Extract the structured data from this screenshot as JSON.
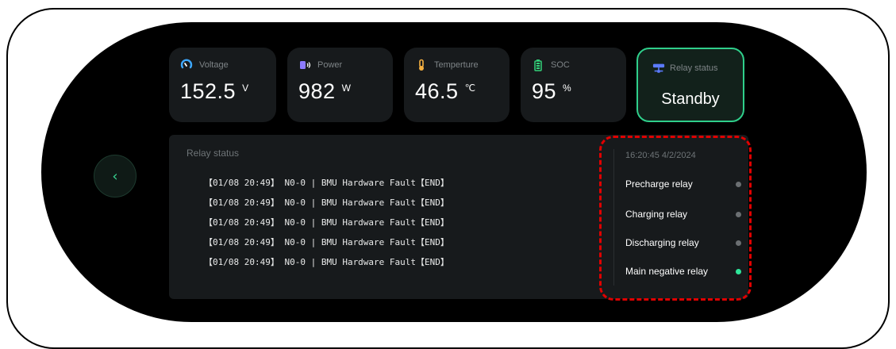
{
  "metrics": [
    {
      "label": "Voltage",
      "value": "152.5",
      "unit": "V",
      "icon": "gauge-icon",
      "icon_color": "#3da8ff"
    },
    {
      "label": "Power",
      "value": "982",
      "unit": "W",
      "icon": "battery-power-icon",
      "icon_color": "#8d7bff"
    },
    {
      "label": "Temperture",
      "value": "46.5",
      "unit": "℃",
      "icon": "thermometer-icon",
      "icon_color": "#f5b041"
    },
    {
      "label": "SOC",
      "value": "95",
      "unit": "%",
      "icon": "battery-icon",
      "icon_color": "#33d17a"
    }
  ],
  "relay_card": {
    "label": "Relay status",
    "status": "Standby",
    "icon": "network-icon",
    "accent": "#2fcf8b"
  },
  "back_button": {
    "glyph": "‹",
    "icon": "chevron-left-icon"
  },
  "panel": {
    "title": "Relay status",
    "log": [
      "【01/08 20:49】 N0-0 | BMU Hardware Fault【END】",
      "【01/08 20:49】 N0-0 | BMU Hardware Fault【END】",
      "【01/08 20:49】 N0-0 | BMU Hardware Fault【END】",
      "【01/08 20:49】 N0-0 | BMU Hardware Fault【END】",
      "【01/08 20:49】 N0-0 | BMU Hardware Fault【END】"
    ]
  },
  "relays": {
    "timestamp": "16:20:45 4/2/2024",
    "items": [
      {
        "label": "Precharge relay",
        "state": "off"
      },
      {
        "label": "Charging relay",
        "state": "off"
      },
      {
        "label": "Discharging relay",
        "state": "off"
      },
      {
        "label": "Main negative relay",
        "state": "on"
      }
    ]
  },
  "colors": {
    "active": "#2fe59a",
    "inactive": "#6b6f72",
    "highlight": "#e00000"
  }
}
